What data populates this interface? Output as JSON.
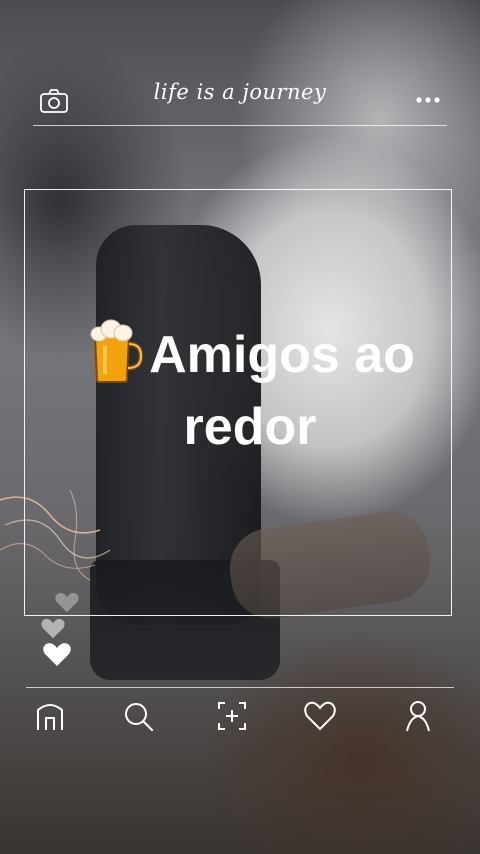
{
  "header": {
    "title": "life is a journey",
    "left_icon": "camera-icon",
    "right_icon": "more-dots-icon"
  },
  "post": {
    "emoji": "beer-mug-icon",
    "headline_line1": "Amigos ao",
    "headline_line2": "redor"
  },
  "likes": {
    "icons": [
      "heart-icon-faded",
      "heart-icon-faded",
      "heart-icon-filled"
    ]
  },
  "nav": {
    "items": [
      {
        "icon": "home-icon"
      },
      {
        "icon": "search-icon"
      },
      {
        "icon": "add-post-icon"
      },
      {
        "icon": "heart-icon"
      },
      {
        "icon": "profile-icon"
      }
    ]
  },
  "colors": {
    "overlay_line": "#ffffff",
    "text": "#ffffff",
    "beer": "#f2a20c"
  }
}
